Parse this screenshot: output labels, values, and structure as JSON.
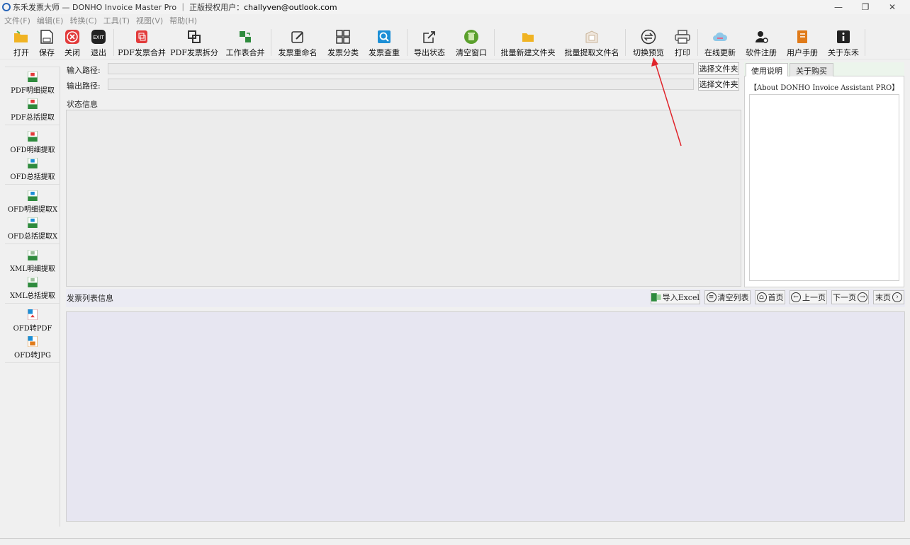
{
  "window": {
    "title": "东禾发票大师 — DONHO Invoice Master Pro ｜ 正版授权用户：",
    "user": "challyven@outlook.com"
  },
  "menu": [
    "文件(F)",
    "编辑(E)",
    "转换(C)",
    "工具(T)",
    "视图(V)",
    "帮助(H)"
  ],
  "toolbar": [
    {
      "label": "打开",
      "icon": "folder-open-icon",
      "color": "#f0b323"
    },
    {
      "label": "保存",
      "icon": "save-icon",
      "color": "#333333"
    },
    {
      "label": "关闭",
      "icon": "close-circle-icon",
      "color": "#e23b3b"
    },
    {
      "label": "退出",
      "icon": "exit-icon",
      "color": "#333333"
    },
    {
      "label": "PDF发票合并",
      "icon": "pdf-merge-icon",
      "color": "#e23b3b"
    },
    {
      "label": "PDF发票拆分",
      "icon": "pdf-split-icon",
      "color": "#333333"
    },
    {
      "label": "工作表合并",
      "icon": "sheet-merge-icon",
      "color": "#2e8b3d"
    },
    {
      "label": "发票重命名",
      "icon": "rename-icon",
      "color": "#333333"
    },
    {
      "label": "发票分类",
      "icon": "classify-icon",
      "color": "#333333"
    },
    {
      "label": "发票查重",
      "icon": "duplicate-check-icon",
      "color": "#1c8fd6"
    },
    {
      "label": "导出状态",
      "icon": "export-icon",
      "color": "#333333"
    },
    {
      "label": "清空窗口",
      "icon": "clear-window-icon",
      "color": "#5aa02c"
    },
    {
      "label": "批量新建文件夹",
      "icon": "new-folder-icon",
      "color": "#f0b323"
    },
    {
      "label": "批量提取文件名",
      "icon": "extract-filename-icon",
      "color": "#c9b49a"
    },
    {
      "label": "切换预览",
      "icon": "switch-preview-icon",
      "color": "#333333"
    },
    {
      "label": "打印",
      "icon": "print-icon",
      "color": "#555555"
    },
    {
      "label": "在线更新",
      "icon": "cloud-update-icon",
      "color": "#e26a8a"
    },
    {
      "label": "软件注册",
      "icon": "register-icon",
      "color": "#333333"
    },
    {
      "label": "用户手册",
      "icon": "manual-icon",
      "color": "#e07b1a"
    },
    {
      "label": "关于东禾",
      "icon": "info-icon",
      "color": "#222222"
    }
  ],
  "sidebar": [
    {
      "label": "PDF明细提取",
      "icon": "xls-icon"
    },
    {
      "label": "PDF总括提取",
      "icon": "xls-icon"
    },
    {
      "label": "OFD明细提取",
      "icon": "xls-icon"
    },
    {
      "label": "OFD总括提取",
      "icon": "xls-icon"
    },
    {
      "label": "OFD明细提取X",
      "icon": "xls-icon"
    },
    {
      "label": "OFD总括提取X",
      "icon": "xls-icon"
    },
    {
      "label": "XML明细提取",
      "icon": "xls-icon"
    },
    {
      "label": "XML总括提取",
      "icon": "xls-icon"
    },
    {
      "label": "OFD转PDF",
      "icon": "pdf-file-icon"
    },
    {
      "label": "OFD转JPG",
      "icon": "jpg-file-icon"
    }
  ],
  "paths": {
    "input_label": "输入路径:",
    "input_value": "",
    "output_label": "输出路径:",
    "output_value": "",
    "select_folder": "选择文件夹"
  },
  "status": {
    "label": "状态信息"
  },
  "tabs": [
    {
      "label": "使用说明",
      "active": true
    },
    {
      "label": "关于购买",
      "active": false
    }
  ],
  "about": {
    "title": "【About DONHO Invoice Assistant PRO】"
  },
  "invoice_list": {
    "title": "发票列表信息",
    "buttons": [
      {
        "label": "导入Excel",
        "icon": "excel-icon"
      },
      {
        "label": "清空列表",
        "icon": "clear-list-icon"
      },
      {
        "label": "首页",
        "icon": "home-icon"
      },
      {
        "label": "上一页",
        "icon": "arrow-left-icon"
      },
      {
        "label": "下一页",
        "icon": "arrow-right-icon"
      },
      {
        "label": "末页",
        "icon": "last-page-icon"
      }
    ]
  },
  "colors": {
    "annotation_arrow": "#e0242b",
    "list_bg": "#e7e6f1",
    "tab_strip": "#ecf5ec"
  }
}
